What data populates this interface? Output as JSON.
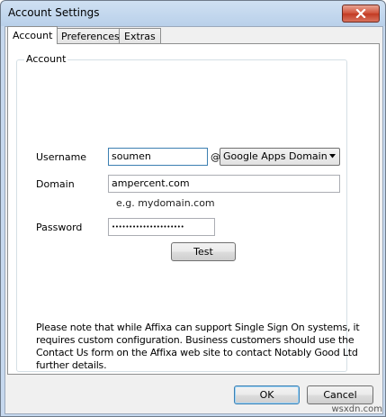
{
  "window": {
    "title": "Account Settings",
    "close_icon": "close-x-icon"
  },
  "tabs": [
    {
      "label": "Account",
      "active": true
    },
    {
      "label": "Preferences",
      "active": false
    },
    {
      "label": "Extras",
      "active": false
    }
  ],
  "account": {
    "group_title": "Account",
    "username": {
      "label": "Username",
      "value": "soumen",
      "at": "@"
    },
    "domain_type": {
      "selected": "Google Apps Domain",
      "icon": "dropdown-arrow-icon"
    },
    "domain": {
      "label": "Domain",
      "value": "ampercent.com",
      "hint": "e.g. mydomain.com"
    },
    "password": {
      "label": "Password",
      "value": "•••••••••••••••••••••"
    },
    "test_button": "Test",
    "note": "Please note that while Affixa can support Single Sign On systems, it requires custom configuration. Business customers should use the Contact Us form on the Affixa web site to contact Notably Good Ltd further details."
  },
  "buttons": {
    "ok": "OK",
    "cancel": "Cancel"
  },
  "watermark": "wsxdn.com"
}
